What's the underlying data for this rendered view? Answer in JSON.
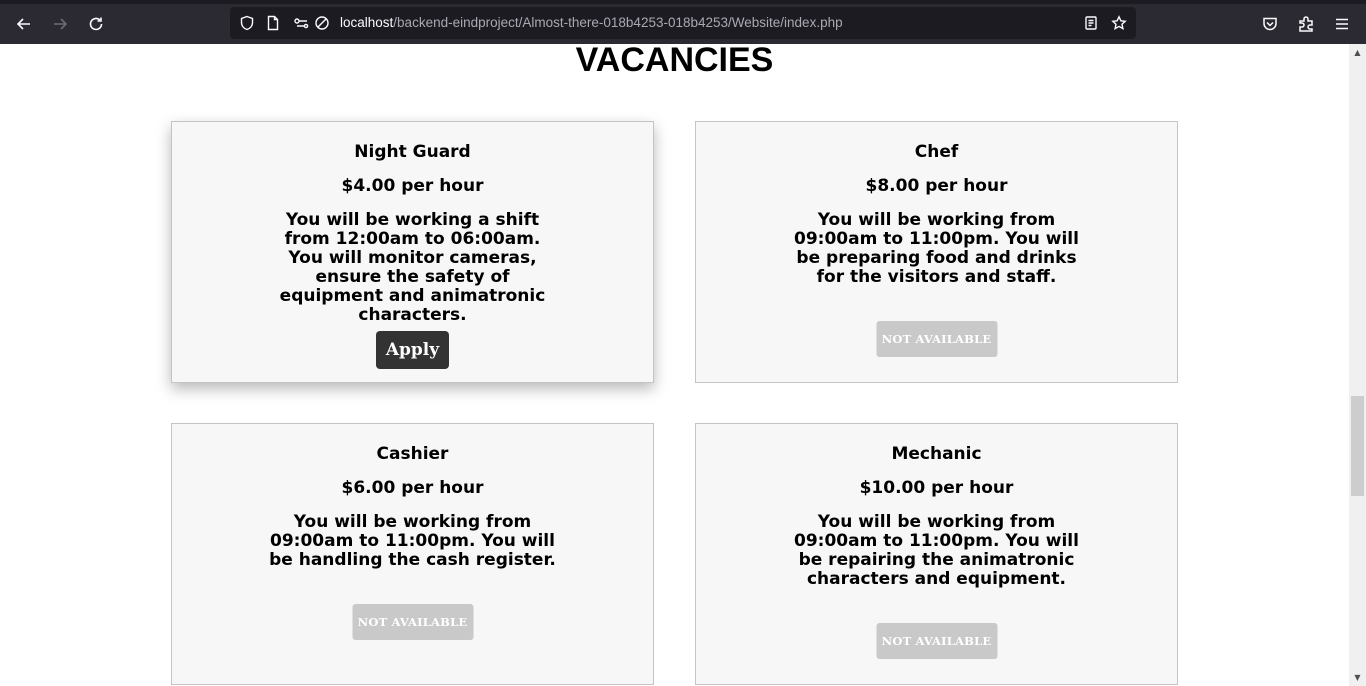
{
  "browser": {
    "url_host": "localhost",
    "url_path": "/backend-eindproject/Almost-there-018b4253-018b4253/Website/index.php"
  },
  "page": {
    "title": "VACANCIES",
    "vacancies": [
      {
        "title": "Night Guard",
        "wage": "$4.00 per hour",
        "description": "You will be working a shift from 12:00am to 06:00am. You will monitor cameras, ensure the safety of equipment and animatronic characters.",
        "button_label": "Apply"
      },
      {
        "title": "Chef",
        "wage": "$8.00 per hour",
        "description": "You will be working from 09:00am to 11:00pm. You will be preparing food and drinks for the visitors and staff.",
        "button_label": "NOT AVAILABLE"
      },
      {
        "title": "Cashier",
        "wage": "$6.00 per hour",
        "description": "You will be working from 09:00am to 11:00pm. You will be handling the cash register.",
        "button_label": "NOT AVAILABLE"
      },
      {
        "title": "Mechanic",
        "wage": "$10.00 per hour",
        "description": "You will be working from 09:00am to 11:00pm. You will be repairing the animatronic characters and equipment.",
        "button_label": "NOT AVAILABLE"
      }
    ]
  }
}
